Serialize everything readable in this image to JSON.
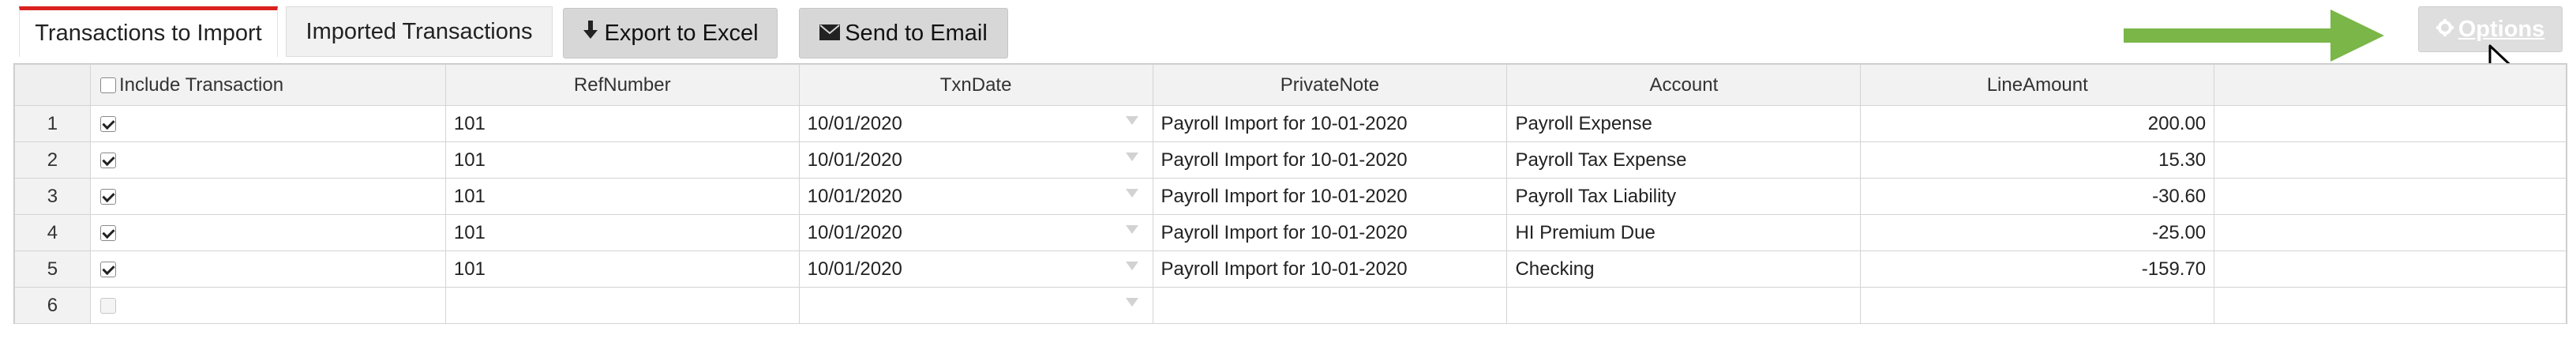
{
  "tabs": [
    {
      "label": "Transactions to Import",
      "active": true
    },
    {
      "label": "Imported Transactions",
      "active": false
    }
  ],
  "toolbar": {
    "export_label": "Export to Excel",
    "export_icon": "download-icon",
    "email_label": "Send to Email",
    "email_icon": "envelope-icon",
    "options_label": "Options",
    "options_icon": "gear-icon"
  },
  "annotation": {
    "arrow_color": "#7ab648"
  },
  "colors": {
    "active_tab_accent": "#d9221f",
    "button_bg": "#d7d7d7"
  },
  "grid": {
    "columns": [
      "Include Transaction",
      "RefNumber",
      "TxnDate",
      "PrivateNote",
      "Account",
      "LineAmount",
      ""
    ],
    "rows": [
      {
        "num": "1",
        "checked": true,
        "ref": "101",
        "date": "10/01/2020",
        "note": "Payroll Import for 10-01-2020",
        "account": "Payroll Expense",
        "amount": "200.00"
      },
      {
        "num": "2",
        "checked": true,
        "ref": "101",
        "date": "10/01/2020",
        "note": "Payroll Import for 10-01-2020",
        "account": "Payroll Tax Expense",
        "amount": "15.30"
      },
      {
        "num": "3",
        "checked": true,
        "ref": "101",
        "date": "10/01/2020",
        "note": "Payroll Import for 10-01-2020",
        "account": "Payroll Tax Liability",
        "amount": "-30.60"
      },
      {
        "num": "4",
        "checked": true,
        "ref": "101",
        "date": "10/01/2020",
        "note": "Payroll Import for 10-01-2020",
        "account": "HI Premium Due",
        "amount": "-25.00"
      },
      {
        "num": "5",
        "checked": true,
        "ref": "101",
        "date": "10/01/2020",
        "note": "Payroll Import for 10-01-2020",
        "account": "Checking",
        "amount": "-159.70"
      },
      {
        "num": "6",
        "checked": false,
        "ref": "",
        "date": "",
        "note": "",
        "account": "",
        "amount": ""
      }
    ]
  }
}
